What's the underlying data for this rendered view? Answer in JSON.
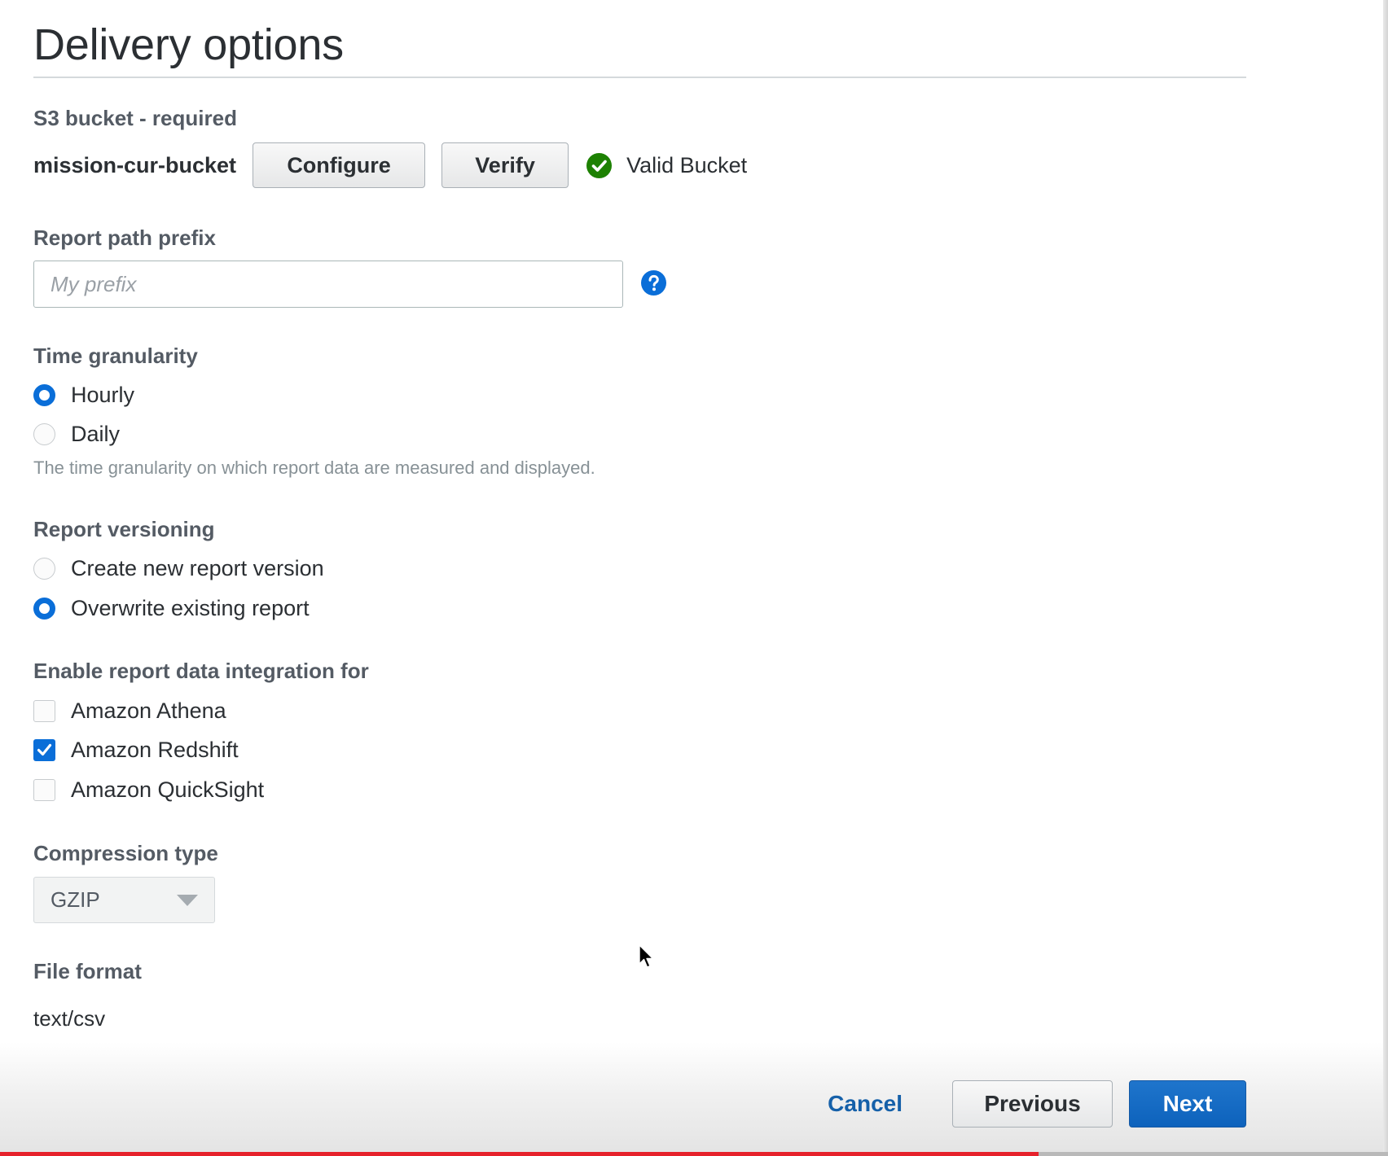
{
  "page": {
    "title": "Delivery options"
  },
  "s3_bucket": {
    "label": "S3 bucket - required",
    "bucket_name": "mission-cur-bucket",
    "configure_label": "Configure",
    "verify_label": "Verify",
    "status_text": "Valid Bucket",
    "status_icon": "check-circle-icon",
    "status_color": "#1d8102"
  },
  "report_path_prefix": {
    "label": "Report path prefix",
    "value": "",
    "placeholder": "My prefix",
    "help_icon": "question-circle-icon"
  },
  "time_granularity": {
    "label": "Time granularity",
    "options": [
      {
        "label": "Hourly",
        "selected": true
      },
      {
        "label": "Daily",
        "selected": false
      }
    ],
    "hint": "The time granularity on which report data are measured and displayed."
  },
  "report_versioning": {
    "label": "Report versioning",
    "options": [
      {
        "label": "Create new report version",
        "selected": false
      },
      {
        "label": "Overwrite existing report",
        "selected": true
      }
    ]
  },
  "integration": {
    "label": "Enable report data integration for",
    "options": [
      {
        "label": "Amazon Athena",
        "checked": false
      },
      {
        "label": "Amazon Redshift",
        "checked": true
      },
      {
        "label": "Amazon QuickSight",
        "checked": false
      }
    ]
  },
  "compression_type": {
    "label": "Compression type",
    "selected": "GZIP"
  },
  "file_format": {
    "label": "File format",
    "value": "text/csv"
  },
  "footer": {
    "cancel_label": "Cancel",
    "previous_label": "Previous",
    "next_label": "Next"
  },
  "video_progress": {
    "fraction": 0.748,
    "fill_color": "#e6212b"
  },
  "colors": {
    "accent": "#0a6ed8",
    "primary_button": "#0d62bc",
    "link": "#1560a9",
    "label": "#545b64"
  }
}
